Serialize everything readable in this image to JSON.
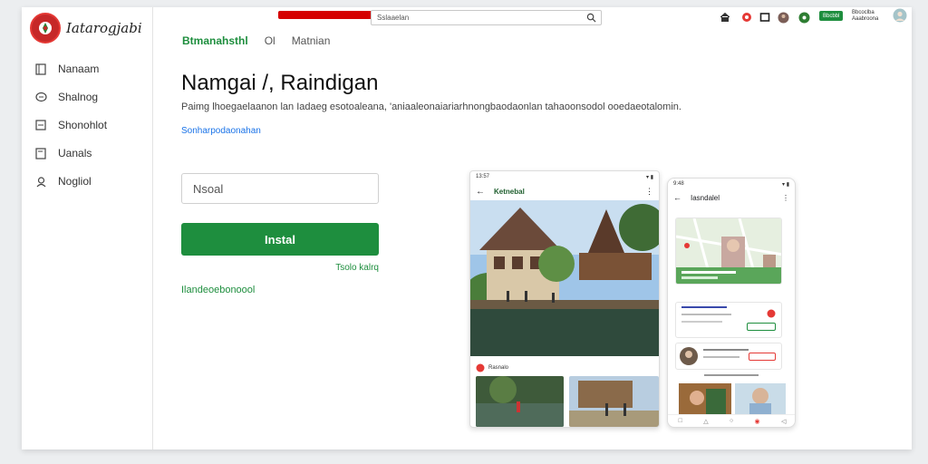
{
  "app": {
    "logo_text": "Iatarogjabi"
  },
  "sidebar": {
    "items": [
      {
        "label": "Nanaam",
        "icon": "document-icon"
      },
      {
        "label": "Shalnog",
        "icon": "chat-icon"
      },
      {
        "label": "Shonohlot",
        "icon": "list-icon"
      },
      {
        "label": "Uanals",
        "icon": "page-icon"
      },
      {
        "label": "Nogliol",
        "icon": "user-icon"
      }
    ]
  },
  "topbar": {
    "search_value": "Sslaaelan",
    "badge_label": "Bbcbbl",
    "account_text": "Bbcoclba Aaabroona"
  },
  "tabs": [
    {
      "label": "Btmanahsthl",
      "active": true
    },
    {
      "label": "Ol",
      "active": false
    },
    {
      "label": "Matnian",
      "active": false
    }
  ],
  "main": {
    "title": "Namgai /, Raindigan",
    "subtitle": "Paimg lhoegaelaanon lan Iadaeg esotoaleana, 'aniaaleonaiariarhnongbaodaonlan tahaoonsodol ooedaeotalomin.",
    "top_link": "Sonharpodaonahan",
    "input_value": "Nsoal",
    "install_label": "Instal",
    "right_link": "Tsolo kalrq",
    "bottom_link": "Ilandeoebonoool"
  },
  "phone1": {
    "time": "13:57",
    "appbar_title": "Ketnebal",
    "section_label": "Rasnalo"
  },
  "phone2": {
    "time": "9:48",
    "appbar_title": "Iasndalel"
  },
  "colors": {
    "brand_green": "#1e8e3e",
    "brand_red": "#d50000",
    "link_blue": "#1a73e8"
  }
}
